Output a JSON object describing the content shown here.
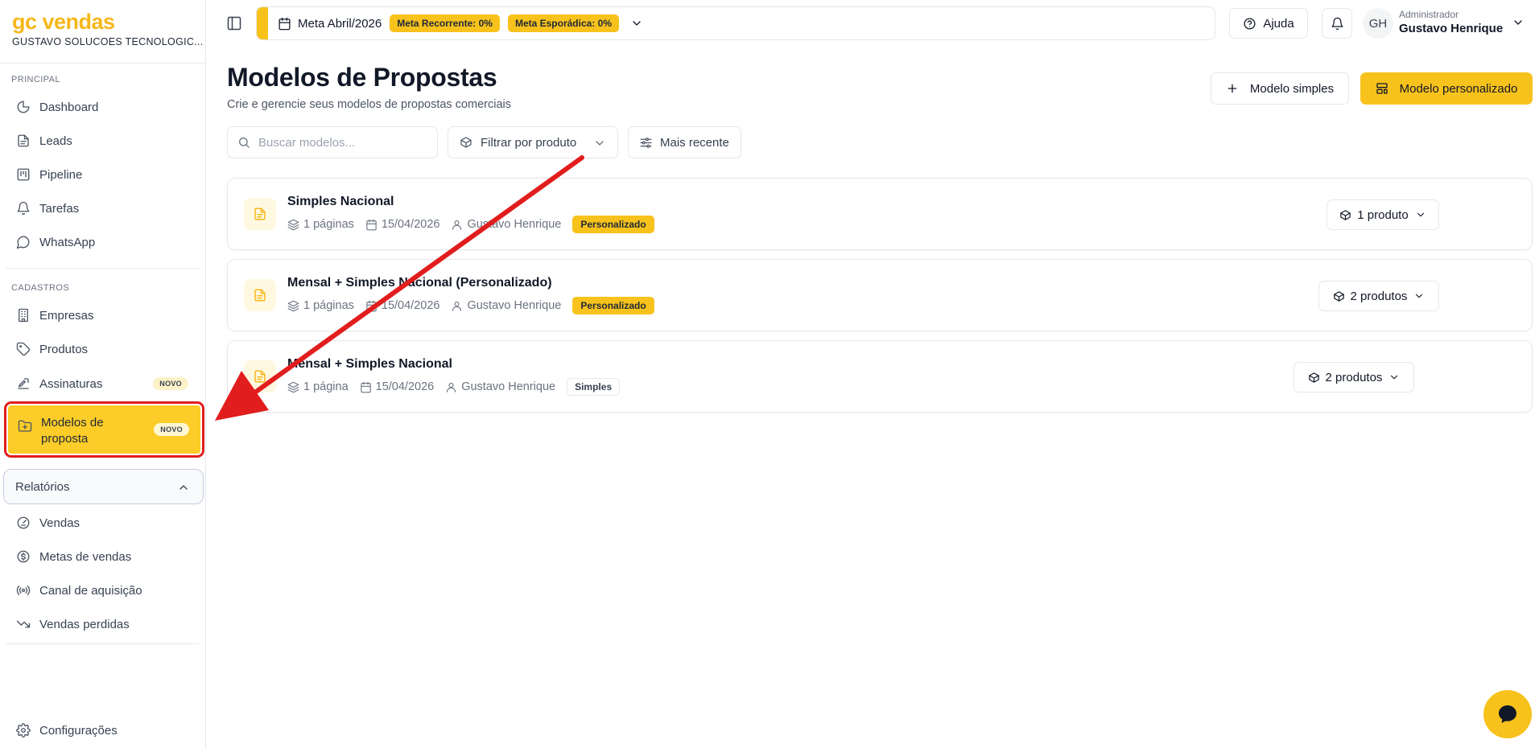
{
  "brand": {
    "name": "gc vendas",
    "company": "GUSTAVO SOLUCOES TECNOLOGIC..."
  },
  "sidebar": {
    "principal_label": "PRINCIPAL",
    "principal": [
      {
        "label": "Dashboard",
        "icon": "pie-chart-icon"
      },
      {
        "label": "Leads",
        "icon": "file-icon"
      },
      {
        "label": "Pipeline",
        "icon": "kanban-icon"
      },
      {
        "label": "Tarefas",
        "icon": "bell-icon"
      },
      {
        "label": "WhatsApp",
        "icon": "message-circle-icon"
      }
    ],
    "cadastros_label": "CADASTROS",
    "cadastros": [
      {
        "label": "Empresas",
        "icon": "building-icon"
      },
      {
        "label": "Produtos",
        "icon": "tag-icon"
      },
      {
        "label": "Assinaturas",
        "icon": "signature-icon",
        "badge": "NOVO"
      },
      {
        "label": "Modelos de proposta",
        "icon": "folder-plus-icon",
        "badge": "NOVO",
        "active": true
      }
    ],
    "relatorios_label": "Relatórios",
    "relatorios": [
      {
        "label": "Vendas",
        "icon": "gauge-icon"
      },
      {
        "label": "Metas de vendas",
        "icon": "dollar-circle-icon"
      },
      {
        "label": "Canal de aquisição",
        "icon": "radio-icon"
      },
      {
        "label": "Vendas perdidas",
        "icon": "trending-down-icon"
      }
    ],
    "settings_label": "Configurações"
  },
  "topbar": {
    "meta_title": "Meta Abril/2026",
    "meta_recorrente": "Meta Recorrente: 0%",
    "meta_esporadica": "Meta Esporádica: 0%",
    "help_label": "Ajuda",
    "avatar_initials": "GH",
    "user_role": "Administrador",
    "user_name": "Gustavo Henrique"
  },
  "page": {
    "title": "Modelos de Propostas",
    "subtitle": "Crie e gerencie seus modelos de propostas comerciais",
    "btn_simple": "Modelo simples",
    "btn_custom": "Modelo personalizado",
    "search_placeholder": "Buscar modelos...",
    "filter_label": "Filtrar por produto",
    "sort_label": "Mais recente"
  },
  "models": [
    {
      "title": "Simples Nacional",
      "pages": "1 páginas",
      "date": "15/04/2026",
      "author": "Gustavo Henrique",
      "tag": "Personalizado",
      "products": "1 produto"
    },
    {
      "title": "Mensal + Simples Nacional (Personalizado)",
      "pages": "1 páginas",
      "date": "15/04/2026",
      "author": "Gustavo Henrique",
      "tag": "Personalizado",
      "products": "2 produtos"
    },
    {
      "title": "Mensal + Simples Nacional",
      "pages": "1 página",
      "date": "15/04/2026",
      "author": "Gustavo Henrique",
      "tag": "Simples",
      "products": "2 produtos"
    }
  ],
  "colors": {
    "accent": "#f8c21c",
    "brand": "#f6b71a",
    "annotation": "#e11d1d"
  }
}
